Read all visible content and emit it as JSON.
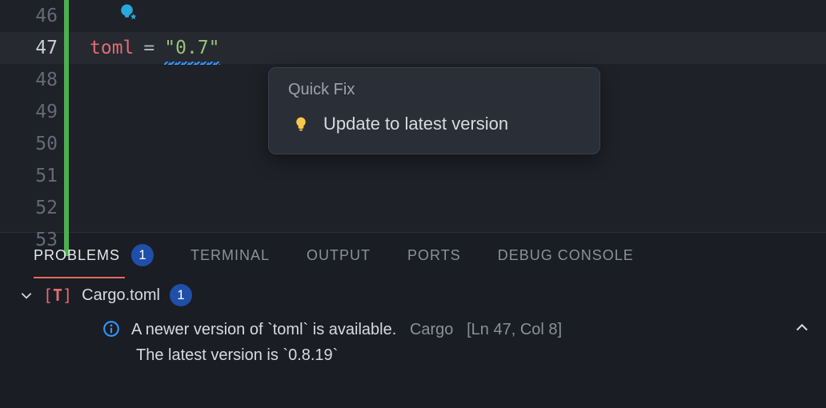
{
  "editor": {
    "visible_lines": [
      "46",
      "47",
      "48",
      "49",
      "50",
      "51",
      "52",
      "53"
    ],
    "active_line": "47",
    "code": {
      "key": "toml",
      "op": "=",
      "value": "\"0.7\""
    }
  },
  "quickfix": {
    "title": "Quick Fix",
    "item": "Update to latest version"
  },
  "panel": {
    "tabs": {
      "problems": "PROBLEMS",
      "problems_badge": "1",
      "terminal": "TERMINAL",
      "output": "OUTPUT",
      "ports": "PORTS",
      "debug": "DEBUG CONSOLE"
    },
    "file": {
      "name": "Cargo.toml",
      "badge": "1"
    },
    "problem": {
      "message": "A newer version of `toml` is available.",
      "source": "Cargo",
      "location": "[Ln 47, Col 8]",
      "detail": "The latest version is `0.8.19`"
    }
  }
}
